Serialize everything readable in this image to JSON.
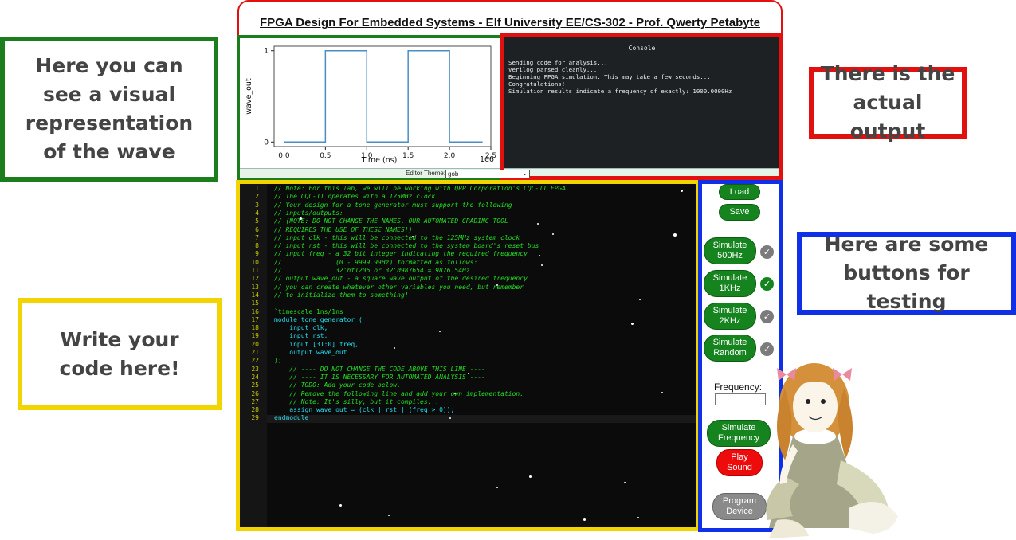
{
  "title": "FPGA Design For Embedded Systems - Elf University EE/CS-302 - Prof. Qwerty Petabyte",
  "callouts": {
    "wave": "Here you can see a visual representation of the wave",
    "output": "There is the actual output",
    "code": "Write your code here!",
    "buttons": "Here are some buttons for testing"
  },
  "graph": {
    "ylabel": "wave_out",
    "xlabel": "Time (ns)",
    "exponent_label": "1e6",
    "x_ticks": [
      "0.0",
      "0.5",
      "1.0",
      "1.5",
      "2.0",
      "2.5"
    ],
    "y_ticks": [
      "0",
      "1"
    ],
    "line_color": "#4a8ec4"
  },
  "chart_data": {
    "type": "line",
    "xlabel": "Time (ns)",
    "ylabel": "wave_out",
    "x_scale_label": "1e6",
    "xlim": [
      -0.12,
      2.5
    ],
    "ylim": [
      -0.05,
      1.05
    ],
    "series": [
      {
        "x": [
          0.0,
          0.5,
          0.5,
          1.0,
          1.0,
          1.5,
          1.5,
          2.0,
          2.0,
          2.4
        ],
        "y": [
          0,
          0,
          1,
          1,
          0,
          0,
          1,
          1,
          0,
          0
        ]
      }
    ]
  },
  "console": {
    "title": "Console",
    "lines": [
      "Sending code for analysis...",
      "Verilog parsed cleanly...",
      "Beginning FPGA simulation. This may take a few seconds...",
      "Congratulations!",
      "Simulation results indicate a frequency of exactly: 1000.0000Hz"
    ]
  },
  "theme": {
    "label": "Editor Theme:",
    "value": "gob"
  },
  "editor": {
    "lines": [
      {
        "n": "1",
        "text": "// Note: For this lab, we will be working with QRP Corporation's CQC-11 FPGA.",
        "cls": "cm"
      },
      {
        "n": "2",
        "text": "// The CQC-11 operates with a 125MHz clock.",
        "cls": "cm"
      },
      {
        "n": "3",
        "text": "// Your design for a tone generator must support the following",
        "cls": "cm"
      },
      {
        "n": "4",
        "text": "// inputs/outputs:",
        "cls": "cm"
      },
      {
        "n": "5",
        "text": "// (NOTE: DO NOT CHANGE THE NAMES. OUR AUTOMATED GRADING TOOL",
        "cls": "cm"
      },
      {
        "n": "6",
        "text": "// REQUIRES THE USE OF THESE NAMES!)",
        "cls": "cm"
      },
      {
        "n": "7",
        "text": "// input clk - this will be connected to the 125MHz system clock",
        "cls": "cm"
      },
      {
        "n": "8",
        "text": "// input rst - this will be connected to the system board's reset bus",
        "cls": "cm"
      },
      {
        "n": "9",
        "text": "// input freq - a 32 bit integer indicating the required frequency",
        "cls": "cm"
      },
      {
        "n": "10",
        "text": "//              (0 - 9999.99Hz) formatted as follows:",
        "cls": "cm"
      },
      {
        "n": "11",
        "text": "//              32'hf1206 or 32'd987654 = 9876.54Hz",
        "cls": "cm"
      },
      {
        "n": "12",
        "text": "// output wave_out - a square wave output of the desired frequency",
        "cls": "cm"
      },
      {
        "n": "13",
        "text": "// you can create whatever other variables you need, but remember",
        "cls": "cm"
      },
      {
        "n": "14",
        "text": "// to initialize them to something!",
        "cls": "cm"
      },
      {
        "n": "15",
        "text": "",
        "cls": "plain"
      },
      {
        "n": "16",
        "text": "`timescale 1ns/1ns",
        "cls": "plain"
      },
      {
        "n": "17",
        "text": "module tone_generator (",
        "cls": "kw"
      },
      {
        "n": "18",
        "text": "    input clk,",
        "cls": "kw"
      },
      {
        "n": "19",
        "text": "    input rst,",
        "cls": "kw"
      },
      {
        "n": "20",
        "text": "    input [31:0] freq,",
        "cls": "kw"
      },
      {
        "n": "21",
        "text": "    output wave_out",
        "cls": "kw"
      },
      {
        "n": "22",
        "text": ");",
        "cls": "plain"
      },
      {
        "n": "23",
        "text": "    // ---- DO NOT CHANGE THE CODE ABOVE THIS LINE ----",
        "cls": "cm"
      },
      {
        "n": "24",
        "text": "    // ---- IT IS NECESSARY FOR AUTOMATED ANALYSIS ----",
        "cls": "cm"
      },
      {
        "n": "25",
        "text": "    // TODO: Add your code below.",
        "cls": "cm"
      },
      {
        "n": "26",
        "text": "    // Remove the following line and add your own implementation.",
        "cls": "cm"
      },
      {
        "n": "27",
        "text": "    // Note: It's silly, but it compiles...",
        "cls": "cm"
      },
      {
        "n": "28",
        "text": "    assign wave_out = (clk | rst | (freq > 0));",
        "cls": "kw"
      },
      {
        "n": "29",
        "text": "endmodule",
        "cls": "kw"
      }
    ]
  },
  "buttons": {
    "load": "Load",
    "save": "Save",
    "sim500_line1": "Simulate",
    "sim500_line2": "500Hz",
    "sim1k_line1": "Simulate",
    "sim1k_line2": "1KHz",
    "sim2k_line1": "Simulate",
    "sim2k_line2": "2KHz",
    "simrand_line1": "Simulate",
    "simrand_line2": "Random",
    "frequency_label": "Frequency:",
    "frequency_value": "",
    "simfreq_line1": "Simulate",
    "simfreq_line2": "Frequency",
    "play_line1": "Play",
    "play_line2": "Sound",
    "program_line1": "Program",
    "program_line2": "Device"
  },
  "status": {
    "sim500": "unchecked",
    "sim1k": "passed",
    "sim2k": "unchecked",
    "simrand": "unchecked"
  },
  "colors": {
    "green_button": "#16841e",
    "red_button": "#ee0b0b",
    "gray_button": "#8a8a8a"
  },
  "icons": {
    "status_check": "check-mark-icon"
  }
}
